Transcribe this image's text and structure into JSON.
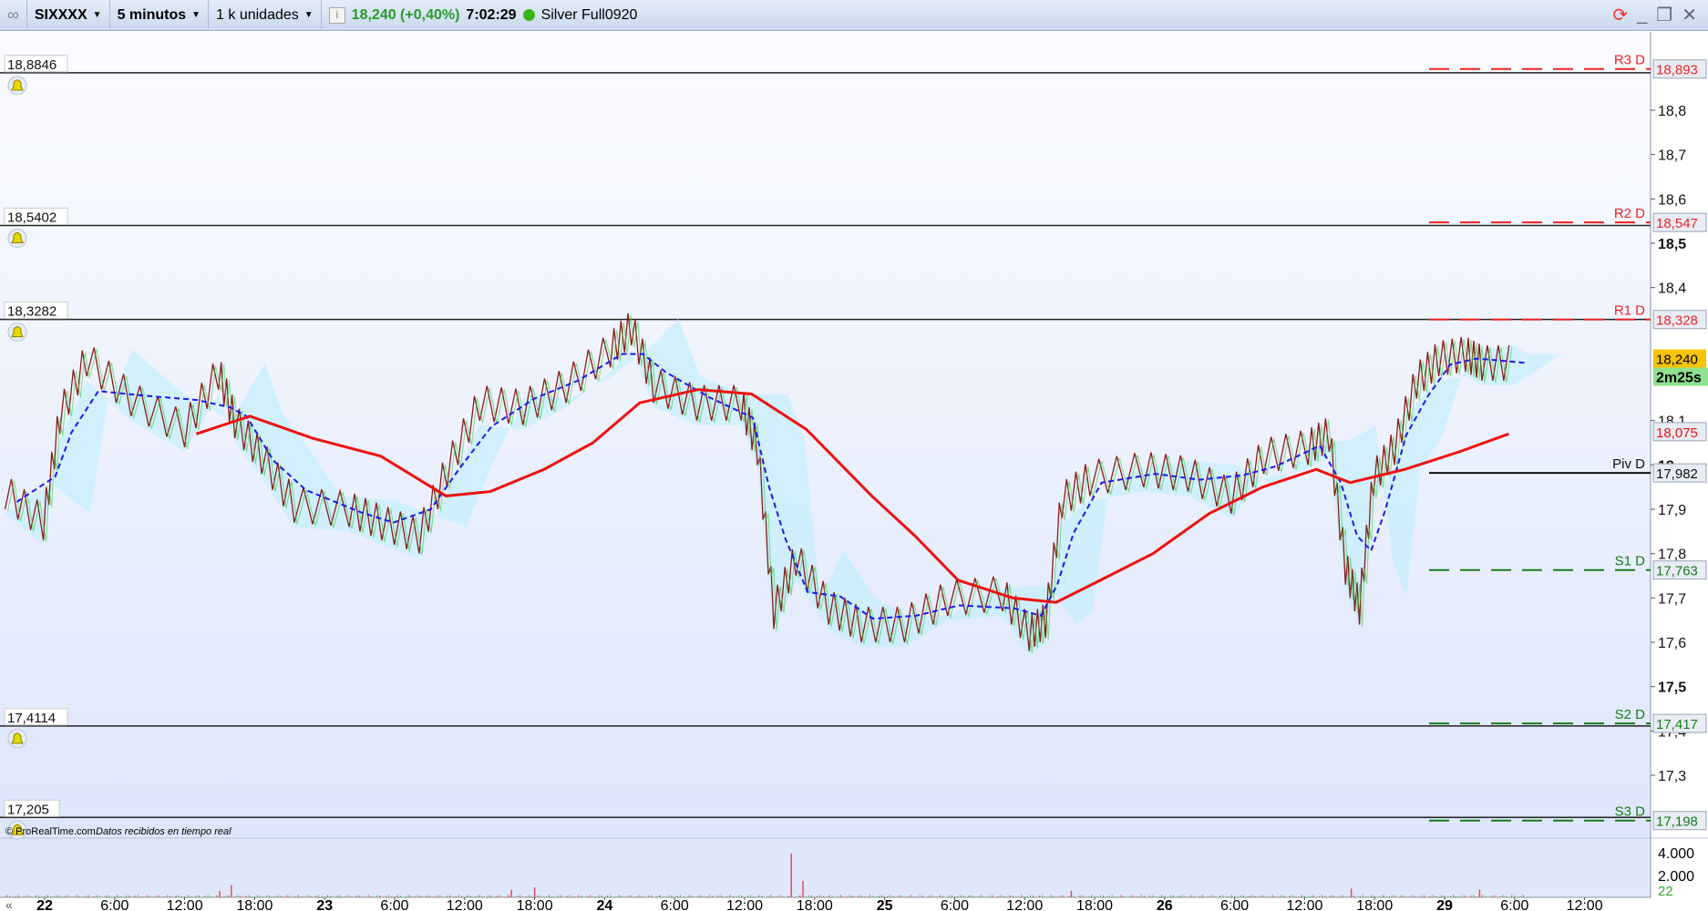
{
  "toolbar": {
    "instrument": "SIXXXX",
    "timeframe": "5 minutos",
    "units": "1 k unidades",
    "last": "18,240 (+0,40%)",
    "time": "7:02:29",
    "feed": "Silver Full0920"
  },
  "colors": {
    "price_up": "#2ecc40",
    "price_down": "#8b1a1a",
    "ma": "#ee1111",
    "dashed": "#1a1aee",
    "resistance": "#ee2222",
    "support": "#1a7a1a",
    "pane_bg": "#eef2fc"
  },
  "footer": {
    "credit": "© ProRealTime.com",
    "status": "Datos recibidos en tiempo real"
  },
  "alert_lines": [
    {
      "value": 18.8846,
      "label": "18,8846"
    },
    {
      "value": 18.5402,
      "label": "18,5402"
    },
    {
      "value": 18.3282,
      "label": "18,3282"
    },
    {
      "value": 17.4114,
      "label": "17,4114"
    },
    {
      "value": 17.205,
      "label": "17,205"
    }
  ],
  "pivots": [
    {
      "name": "R3 D",
      "value": 18.893,
      "label": "18,893",
      "kind": "r"
    },
    {
      "name": "R2 D",
      "value": 18.547,
      "label": "18,547",
      "kind": "r"
    },
    {
      "name": "R1 D",
      "value": 18.328,
      "label": "18,328",
      "kind": "r"
    },
    {
      "name": "Piv D",
      "value": 17.982,
      "label": "17,982",
      "kind": "p"
    },
    {
      "name": "S1 D",
      "value": 17.763,
      "label": "17,763",
      "kind": "s"
    },
    {
      "name": "S2 D",
      "value": 17.417,
      "label": "17,417",
      "kind": "s"
    },
    {
      "name": "S3 D",
      "value": 17.198,
      "label": "17,198",
      "kind": "s"
    }
  ],
  "right_badges": {
    "last": "18,240",
    "countdown": "2m25s",
    "ma": "18,075"
  },
  "chart_data": {
    "type": "line",
    "ylim": [
      17.15,
      18.98
    ],
    "xlim_hours": [
      -3.8,
      148
    ],
    "y_ticks": [
      {
        "v": 18.8,
        "l": "18,8"
      },
      {
        "v": 18.7,
        "l": "18,7"
      },
      {
        "v": 18.6,
        "l": "18,6"
      },
      {
        "v": 18.5,
        "l": "18,5",
        "bold": true
      },
      {
        "v": 18.4,
        "l": "18,4"
      },
      {
        "v": 18.1,
        "l": "18,1"
      },
      {
        "v": 18.0,
        "l": "18",
        "bold": true
      },
      {
        "v": 17.9,
        "l": "17,9"
      },
      {
        "v": 17.8,
        "l": "17,8"
      },
      {
        "v": 17.7,
        "l": "17,7"
      },
      {
        "v": 17.6,
        "l": "17,6"
      },
      {
        "v": 17.5,
        "l": "17,5",
        "bold": true
      },
      {
        "v": 17.4,
        "l": "17,4"
      },
      {
        "v": 17.3,
        "l": "17,3"
      }
    ],
    "x_ticks": [
      {
        "t": 0,
        "l": "22",
        "bold": true
      },
      {
        "t": 6,
        "l": "6:00"
      },
      {
        "t": 12,
        "l": "12:00"
      },
      {
        "t": 18,
        "l": "18:00"
      },
      {
        "t": 24,
        "l": "23",
        "bold": true
      },
      {
        "t": 30,
        "l": "6:00"
      },
      {
        "t": 36,
        "l": "12:00"
      },
      {
        "t": 42,
        "l": "18:00"
      },
      {
        "t": 48,
        "l": "24",
        "bold": true
      },
      {
        "t": 54,
        "l": "6:00"
      },
      {
        "t": 60,
        "l": "12:00"
      },
      {
        "t": 66,
        "l": "18:00"
      },
      {
        "t": 72,
        "l": "25",
        "bold": true
      },
      {
        "t": 78,
        "l": "6:00"
      },
      {
        "t": 84,
        "l": "12:00"
      },
      {
        "t": 90,
        "l": "18:00"
      },
      {
        "t": 96,
        "l": "26",
        "bold": true
      },
      {
        "t": 102,
        "l": "6:00"
      },
      {
        "t": 108,
        "l": "12:00"
      },
      {
        "t": 114,
        "l": "18:00"
      },
      {
        "t": 120,
        "l": "29",
        "bold": true
      },
      {
        "t": 126,
        "l": "6:00"
      },
      {
        "t": 132,
        "l": "12:00"
      }
    ],
    "series": [
      {
        "name": "price",
        "points": [
          [
            -3.4,
            17.94
          ],
          [
            -0.1,
            17.87
          ],
          [
            1.3,
            18.11
          ],
          [
            3.6,
            18.24
          ],
          [
            7.4,
            18.15
          ],
          [
            12.0,
            18.08
          ],
          [
            14.9,
            18.21
          ],
          [
            16.3,
            18.1
          ],
          [
            18.6,
            18.02
          ],
          [
            21.4,
            17.91
          ],
          [
            26.1,
            17.9
          ],
          [
            28.9,
            17.87
          ],
          [
            32.1,
            17.84
          ],
          [
            34.5,
            17.99
          ],
          [
            37.3,
            18.14
          ],
          [
            41.0,
            18.13
          ],
          [
            44.7,
            18.18
          ],
          [
            48.5,
            18.26
          ],
          [
            50.3,
            18.31
          ],
          [
            52.2,
            18.18
          ],
          [
            55.9,
            18.14
          ],
          [
            59.7,
            18.14
          ],
          [
            61.1,
            18.04
          ],
          [
            62.5,
            17.67
          ],
          [
            64.4,
            17.79
          ],
          [
            67.2,
            17.68
          ],
          [
            70.0,
            17.64
          ],
          [
            73.7,
            17.64
          ],
          [
            77.4,
            17.7
          ],
          [
            82.1,
            17.71
          ],
          [
            84.4,
            17.62
          ],
          [
            85.8,
            17.65
          ],
          [
            87.2,
            17.92
          ],
          [
            89.6,
            17.97
          ],
          [
            94.2,
            17.99
          ],
          [
            98.0,
            17.98
          ],
          [
            101.7,
            17.93
          ],
          [
            104.5,
            18.02
          ],
          [
            108.3,
            18.04
          ],
          [
            110.1,
            18.07
          ],
          [
            111.5,
            17.77
          ],
          [
            112.7,
            17.68
          ],
          [
            113.9,
            17.97
          ],
          [
            115.7,
            18.04
          ],
          [
            117.6,
            18.19
          ],
          [
            119.5,
            18.24
          ],
          [
            121.8,
            18.25
          ],
          [
            123.2,
            18.23
          ],
          [
            126.0,
            18.23
          ]
        ]
      },
      {
        "name": "moving-average",
        "points": [
          [
            13,
            18.07
          ],
          [
            17.6,
            18.11
          ],
          [
            23,
            18.06
          ],
          [
            28.8,
            18.02
          ],
          [
            34.4,
            17.93
          ],
          [
            38.2,
            17.94
          ],
          [
            42.8,
            17.99
          ],
          [
            47,
            18.05
          ],
          [
            51,
            18.14
          ],
          [
            56,
            18.17
          ],
          [
            60.6,
            18.16
          ],
          [
            65.3,
            18.08
          ],
          [
            70.9,
            17.93
          ],
          [
            74.6,
            17.84
          ],
          [
            78.3,
            17.74
          ],
          [
            83,
            17.7
          ],
          [
            86.7,
            17.69
          ],
          [
            90.5,
            17.74
          ],
          [
            95,
            17.8
          ],
          [
            99.8,
            17.89
          ],
          [
            104.4,
            17.95
          ],
          [
            109,
            17.99
          ],
          [
            111.9,
            17.96
          ],
          [
            116.6,
            17.99
          ],
          [
            121.3,
            18.03
          ],
          [
            125.5,
            18.07
          ]
        ]
      }
    ],
    "volume": {
      "y_ticks": [
        {
          "v": 4000,
          "l": "4.000"
        },
        {
          "v": 2000,
          "l": "2.000"
        }
      ],
      "last": "22",
      "spikes": [
        [
          15,
          600
        ],
        [
          16,
          1100
        ],
        [
          40,
          700
        ],
        [
          42,
          900
        ],
        [
          64,
          4000
        ],
        [
          65,
          1500
        ],
        [
          88,
          600
        ],
        [
          112,
          800
        ],
        [
          123,
          700
        ]
      ]
    }
  }
}
